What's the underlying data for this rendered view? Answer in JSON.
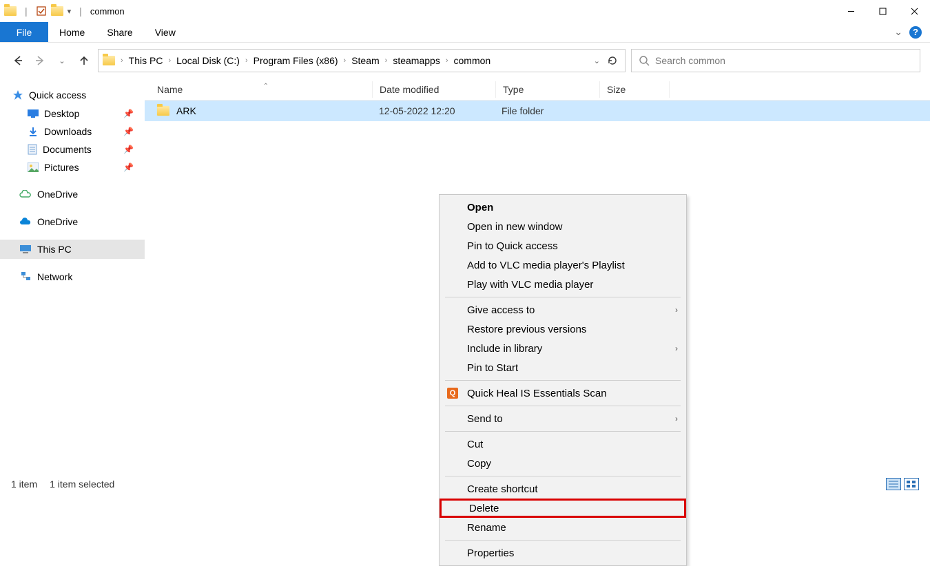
{
  "window": {
    "title": "common",
    "controls": {
      "min": "–",
      "max": "▢",
      "close": "✕"
    }
  },
  "ribbon": {
    "file": "File",
    "tabs": [
      "Home",
      "Share",
      "View"
    ]
  },
  "breadcrumb": [
    "This PC",
    "Local Disk (C:)",
    "Program Files (x86)",
    "Steam",
    "steamapps",
    "common"
  ],
  "search": {
    "placeholder": "Search common"
  },
  "sidebar": {
    "quick_access": "Quick access",
    "quick_items": [
      {
        "label": "Desktop",
        "pinned": true
      },
      {
        "label": "Downloads",
        "pinned": true
      },
      {
        "label": "Documents",
        "pinned": true
      },
      {
        "label": "Pictures",
        "pinned": true
      }
    ],
    "roots": [
      {
        "label": "OneDrive",
        "icon": "cloud-outline"
      },
      {
        "label": "OneDrive",
        "icon": "cloud-blue"
      },
      {
        "label": "This PC",
        "icon": "pc",
        "selected": true
      },
      {
        "label": "Network",
        "icon": "network"
      }
    ]
  },
  "columns": {
    "name": "Name",
    "date": "Date modified",
    "type": "Type",
    "size": "Size"
  },
  "rows": [
    {
      "name": "ARK",
      "date": "12-05-2022 12:20",
      "type": "File folder"
    }
  ],
  "status": {
    "count": "1 item",
    "selected": "1 item selected"
  },
  "context_menu": {
    "items": [
      {
        "label": "Open",
        "bold": true
      },
      {
        "label": "Open in new window"
      },
      {
        "label": "Pin to Quick access"
      },
      {
        "label": "Add to VLC media player's Playlist"
      },
      {
        "label": "Play with VLC media player"
      },
      {
        "sep": true
      },
      {
        "label": "Give access to",
        "submenu": true
      },
      {
        "label": "Restore previous versions"
      },
      {
        "label": "Include in library",
        "submenu": true
      },
      {
        "label": "Pin to Start"
      },
      {
        "sep": true
      },
      {
        "label": "Quick Heal IS Essentials Scan",
        "icon": "quickheal"
      },
      {
        "sep": true
      },
      {
        "label": "Send to",
        "submenu": true
      },
      {
        "sep": true
      },
      {
        "label": "Cut"
      },
      {
        "label": "Copy"
      },
      {
        "sep": true
      },
      {
        "label": "Create shortcut"
      },
      {
        "label": "Delete",
        "highlight": true
      },
      {
        "label": "Rename"
      },
      {
        "sep": true
      },
      {
        "label": "Properties"
      }
    ]
  }
}
